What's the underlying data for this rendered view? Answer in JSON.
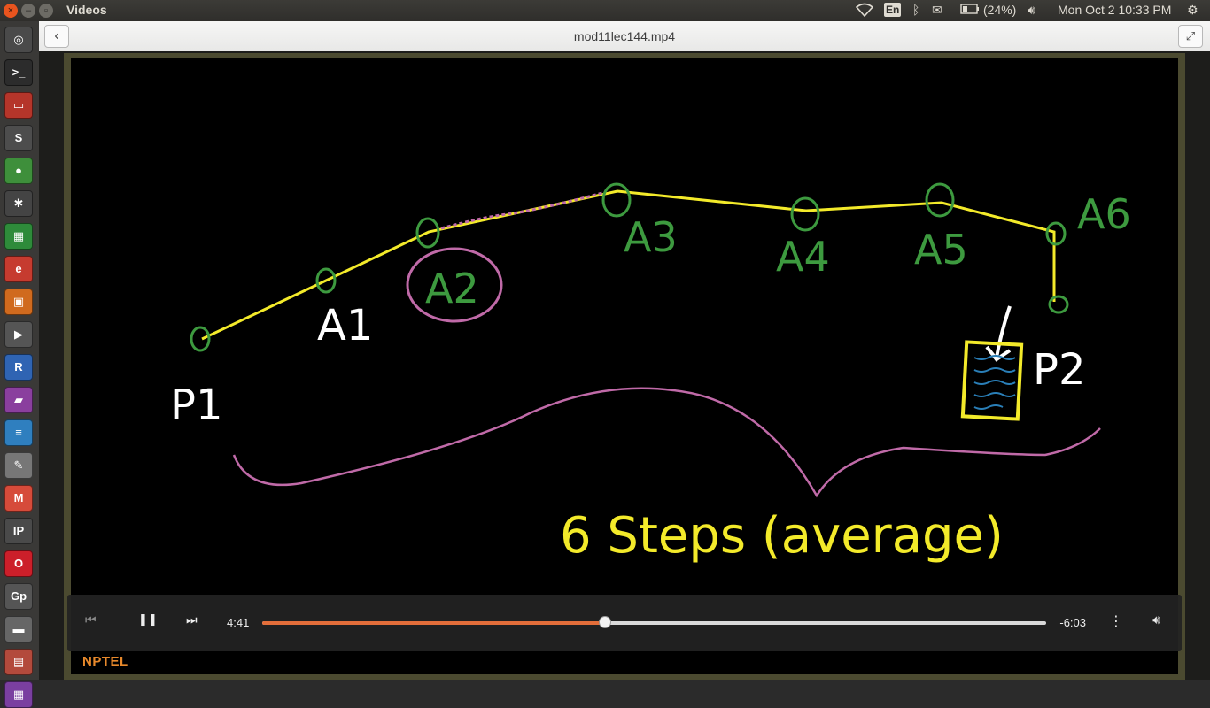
{
  "app": {
    "title": "Videos"
  },
  "window": {
    "file_title": "mod11lec144.mp4"
  },
  "tray": {
    "keyboard": "En",
    "battery": "(24%)",
    "clock": "Mon Oct  2 10:33 PM"
  },
  "launcher": {
    "items": [
      {
        "name": "ubuntu-dash-icon",
        "glyph": "◎",
        "color": "#4a4a4a"
      },
      {
        "name": "terminal-icon",
        "glyph": ">_",
        "color": "#2c2c2c"
      },
      {
        "name": "files-icon",
        "glyph": "▭",
        "color": "#b5352a"
      },
      {
        "name": "sublime-text-icon",
        "glyph": "S",
        "color": "#4d4d4d"
      },
      {
        "name": "chrome-icon",
        "glyph": "●",
        "color": "#3e8f3b"
      },
      {
        "name": "settings-icon",
        "glyph": "✱",
        "color": "#444"
      },
      {
        "name": "spreadsheet-icon",
        "glyph": "▦",
        "color": "#2e8b3a"
      },
      {
        "name": "pdf-viewer-icon",
        "glyph": "e",
        "color": "#c63b2f"
      },
      {
        "name": "presentation-icon",
        "glyph": "▣",
        "color": "#d06a1e"
      },
      {
        "name": "video-editor-icon",
        "glyph": "▶",
        "color": "#555"
      },
      {
        "name": "r-language-icon",
        "glyph": "R",
        "color": "#2f64b3"
      },
      {
        "name": "media-player-icon",
        "glyph": "▰",
        "color": "#8a3f9e"
      },
      {
        "name": "document-icon",
        "glyph": "≡",
        "color": "#2f7fbf"
      },
      {
        "name": "text-editor-icon",
        "glyph": "✎",
        "color": "#777"
      },
      {
        "name": "gmail-icon",
        "glyph": "M",
        "color": "#d64b3a"
      },
      {
        "name": "ipython-icon",
        "glyph": "IP",
        "color": "#4a4a4a"
      },
      {
        "name": "opera-icon",
        "glyph": "O",
        "color": "#cc1f2a"
      },
      {
        "name": "gp-icon",
        "glyph": "Gp",
        "color": "#555"
      },
      {
        "name": "drive-icon",
        "glyph": "▬",
        "color": "#666"
      },
      {
        "name": "archive-icon",
        "glyph": "▤",
        "color": "#b34a3c"
      },
      {
        "name": "app-icon",
        "glyph": "▦",
        "color": "#7a3fa0"
      }
    ]
  },
  "whiteboard": {
    "nodes": {
      "p1": "P1",
      "a1": "A1",
      "a2": "A2",
      "a3": "A3",
      "a4": "A4",
      "a5": "A5",
      "a6": "A6",
      "p2": "P2"
    },
    "caption": "6 Steps (average)"
  },
  "player": {
    "elapsed": "4:41",
    "remaining": "-6:03",
    "progress": 0.437,
    "watermark": "NPTEL"
  },
  "colors": {
    "accent": "#e36e3a",
    "chalk_yellow": "#f3ea2a",
    "chalk_green": "#3d9a3f",
    "chalk_pink": "#c06aa8",
    "chalk_white": "#ffffff"
  }
}
